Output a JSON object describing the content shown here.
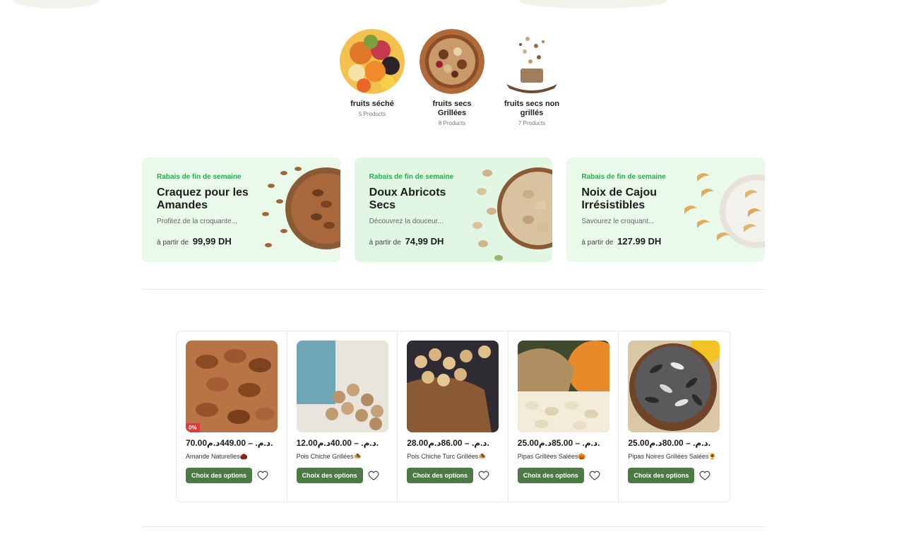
{
  "categories": [
    {
      "name": "fruits séché",
      "count": "5 Products"
    },
    {
      "name": "fruits secs Grillées",
      "count": "8 Products"
    },
    {
      "name": "fruits secs non grillés",
      "count": "7 Products"
    }
  ],
  "banners": [
    {
      "tag": "Rabais de fin de semaine",
      "title": "Craquez pour les Amandes",
      "desc": "Profitez de la croquante...",
      "price_prefix": "à partir de",
      "price": "99,99 DH"
    },
    {
      "tag": "Rabais de fin de semaine",
      "title": "Doux Abricots Secs",
      "desc": "Découvrez la douceur...",
      "price_prefix": "à partir de",
      "price": "74,99 DH"
    },
    {
      "tag": "Rabais de fin de semaine",
      "title": "Noix de Cajou Irrésistibles",
      "desc": "Savourez le croquant...",
      "price_prefix": "à partir de",
      "price": "127.99 DH"
    }
  ],
  "products": [
    {
      "price": "70.00د.م. – 449.00د.م.",
      "name": "Amande Naturelles🌰",
      "badge": "0%",
      "button": "Choix des options"
    },
    {
      "price": "12.00د.م. – 40.00د.م.",
      "name": "Pois Chiche Grillées🧆",
      "button": "Choix des options"
    },
    {
      "price": "28.00د.م. – 86.00د.م.",
      "name": "Pois Chiche Turc Grillées🧆",
      "button": "Choix des options"
    },
    {
      "price": "25.00د.م. – 85.00د.م.",
      "name": "Pipas Grillées Salées🎃",
      "button": "Choix des options"
    },
    {
      "price": "25.00د.م. – 80.00د.م.",
      "name": "Pipas Noires Grillées Salées🌻",
      "button": "Choix des options"
    }
  ],
  "colors": {
    "accent_green": "#4b7a45",
    "banner_bg": "#e2f7e3",
    "tag_green": "#2fa84f",
    "sale_badge": "#e0393e"
  }
}
